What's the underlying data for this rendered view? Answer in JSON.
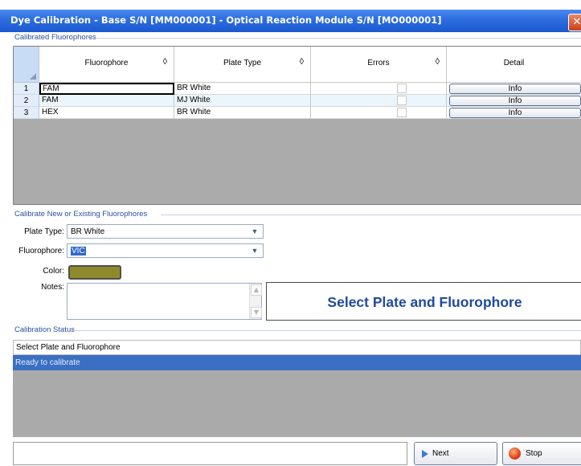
{
  "window": {
    "title": "Dye Calibration - Base S/N [MM000001] - Optical Reaction Module S/N [MO000001]",
    "close_glyph": "✕"
  },
  "calibrated": {
    "section_label": "Calibrated Fluorophores",
    "columns": [
      {
        "label": "Fluorophore",
        "sortable": true
      },
      {
        "label": "Plate Type",
        "sortable": true
      },
      {
        "label": "Errors",
        "sortable": true
      },
      {
        "label": "Detail",
        "sortable": false
      }
    ],
    "sort_glyph": "◊",
    "rows": [
      {
        "num": "1",
        "fluorophore": "FAM",
        "plate_type": "BR White",
        "errors": false,
        "detail": "Info"
      },
      {
        "num": "2",
        "fluorophore": "FAM",
        "plate_type": "MJ White",
        "errors": false,
        "detail": "Info"
      },
      {
        "num": "3",
        "fluorophore": "HEX",
        "plate_type": "BR White",
        "errors": false,
        "detail": "Info"
      }
    ]
  },
  "calibrate": {
    "section_label": "Calibrate New or Existing Fluorophores",
    "plate_type_label": "Plate Type:",
    "plate_type_value": "BR White",
    "fluorophore_label": "Fluorophore:",
    "fluorophore_value": "VIC",
    "color_label": "Color:",
    "color_value": "#8f8a2a",
    "notes_label": "Notes:",
    "notes_value": "",
    "message": "Select Plate and Fluorophore"
  },
  "status": {
    "section_label": "Calibration Status",
    "line1": "Select Plate and Fluorophore",
    "line2": "Ready to calibrate"
  },
  "buttons": {
    "next": "Next",
    "stop": "Stop"
  },
  "colors": {
    "title_bar": "#2f6fe0",
    "status_highlight": "#3a6fc4",
    "message_text": "#1f4a9a"
  }
}
